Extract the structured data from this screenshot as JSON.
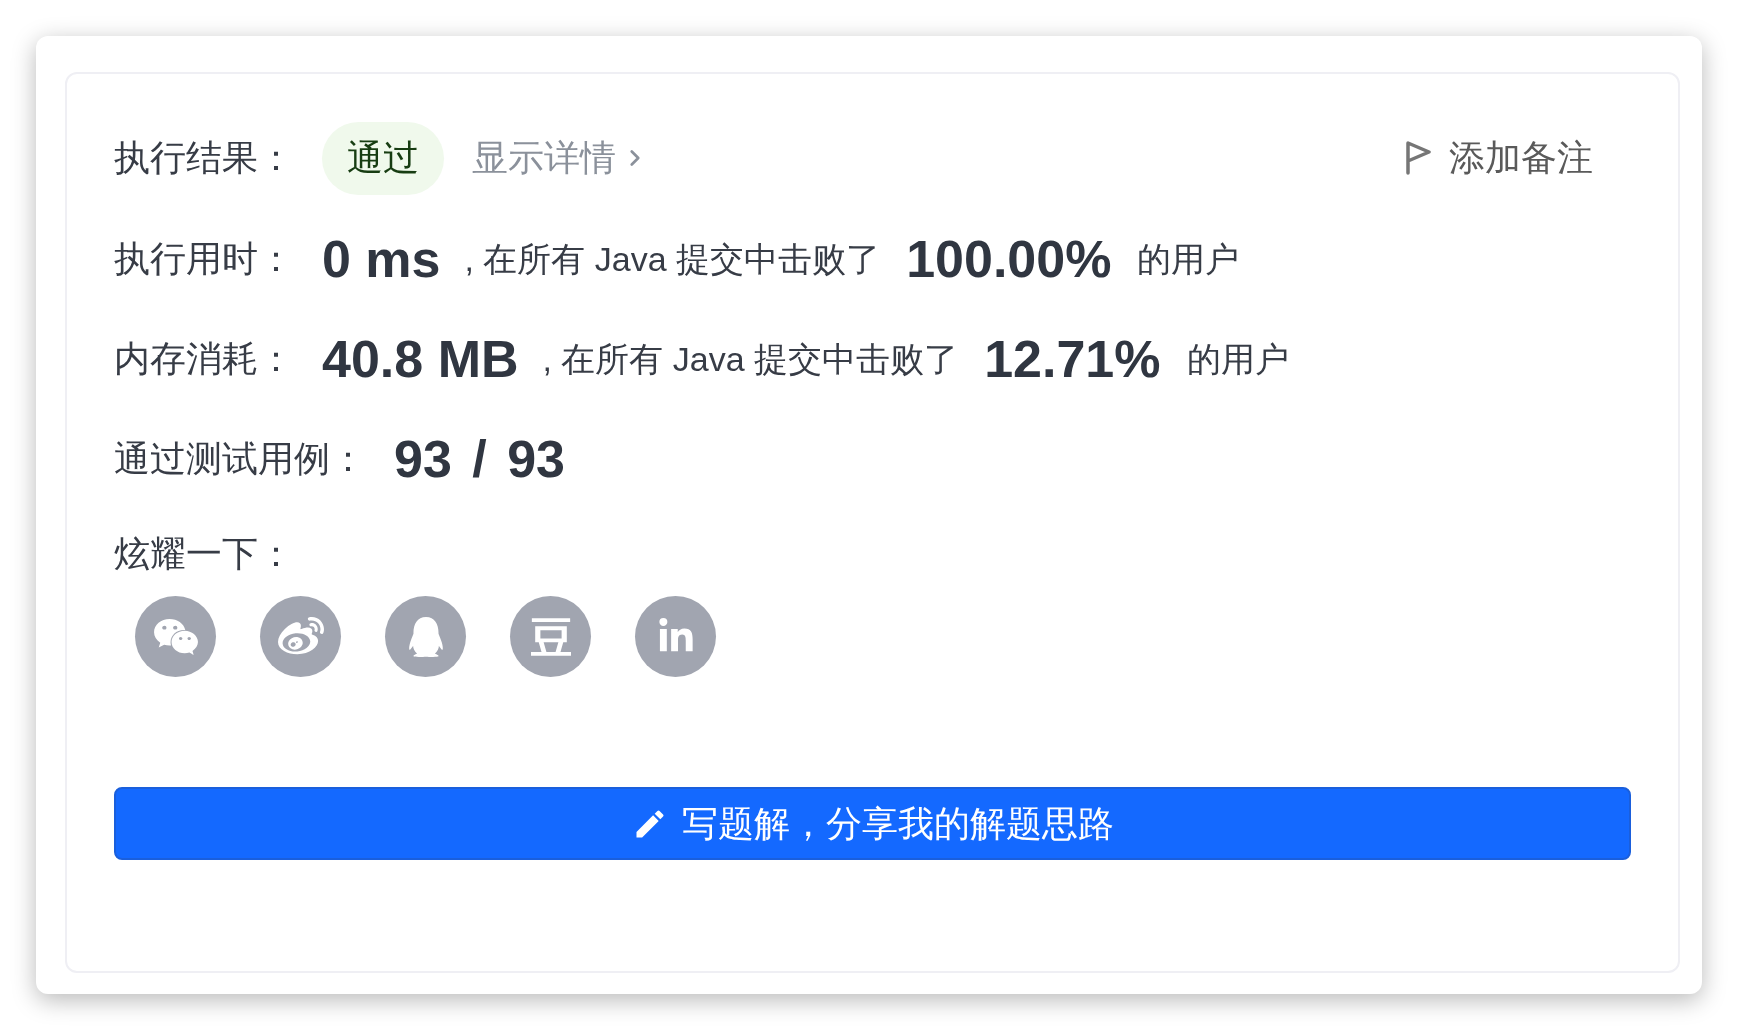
{
  "result": {
    "label": "执行结果：",
    "status": {
      "text": "通过",
      "kind": "accepted"
    },
    "details_link": "显示详情",
    "add_note_button": "添加备注"
  },
  "stats": [
    {
      "label": "执行用时：",
      "value": "0 ms",
      "comparison": ", 在所有 Java 提交中击败了",
      "percentile": "100.00%",
      "suffix": "的用户"
    },
    {
      "label": "内存消耗：",
      "value": "40.8 MB",
      "comparison": ", 在所有 Java 提交中击败了",
      "percentile": "12.71%",
      "suffix": "的用户"
    }
  ],
  "test_cases": {
    "label": "通过测试用例：",
    "value": "93 / 93"
  },
  "share": {
    "label": "炫耀一下："
  },
  "solution_button": "写题解，分享我的解题思路"
}
